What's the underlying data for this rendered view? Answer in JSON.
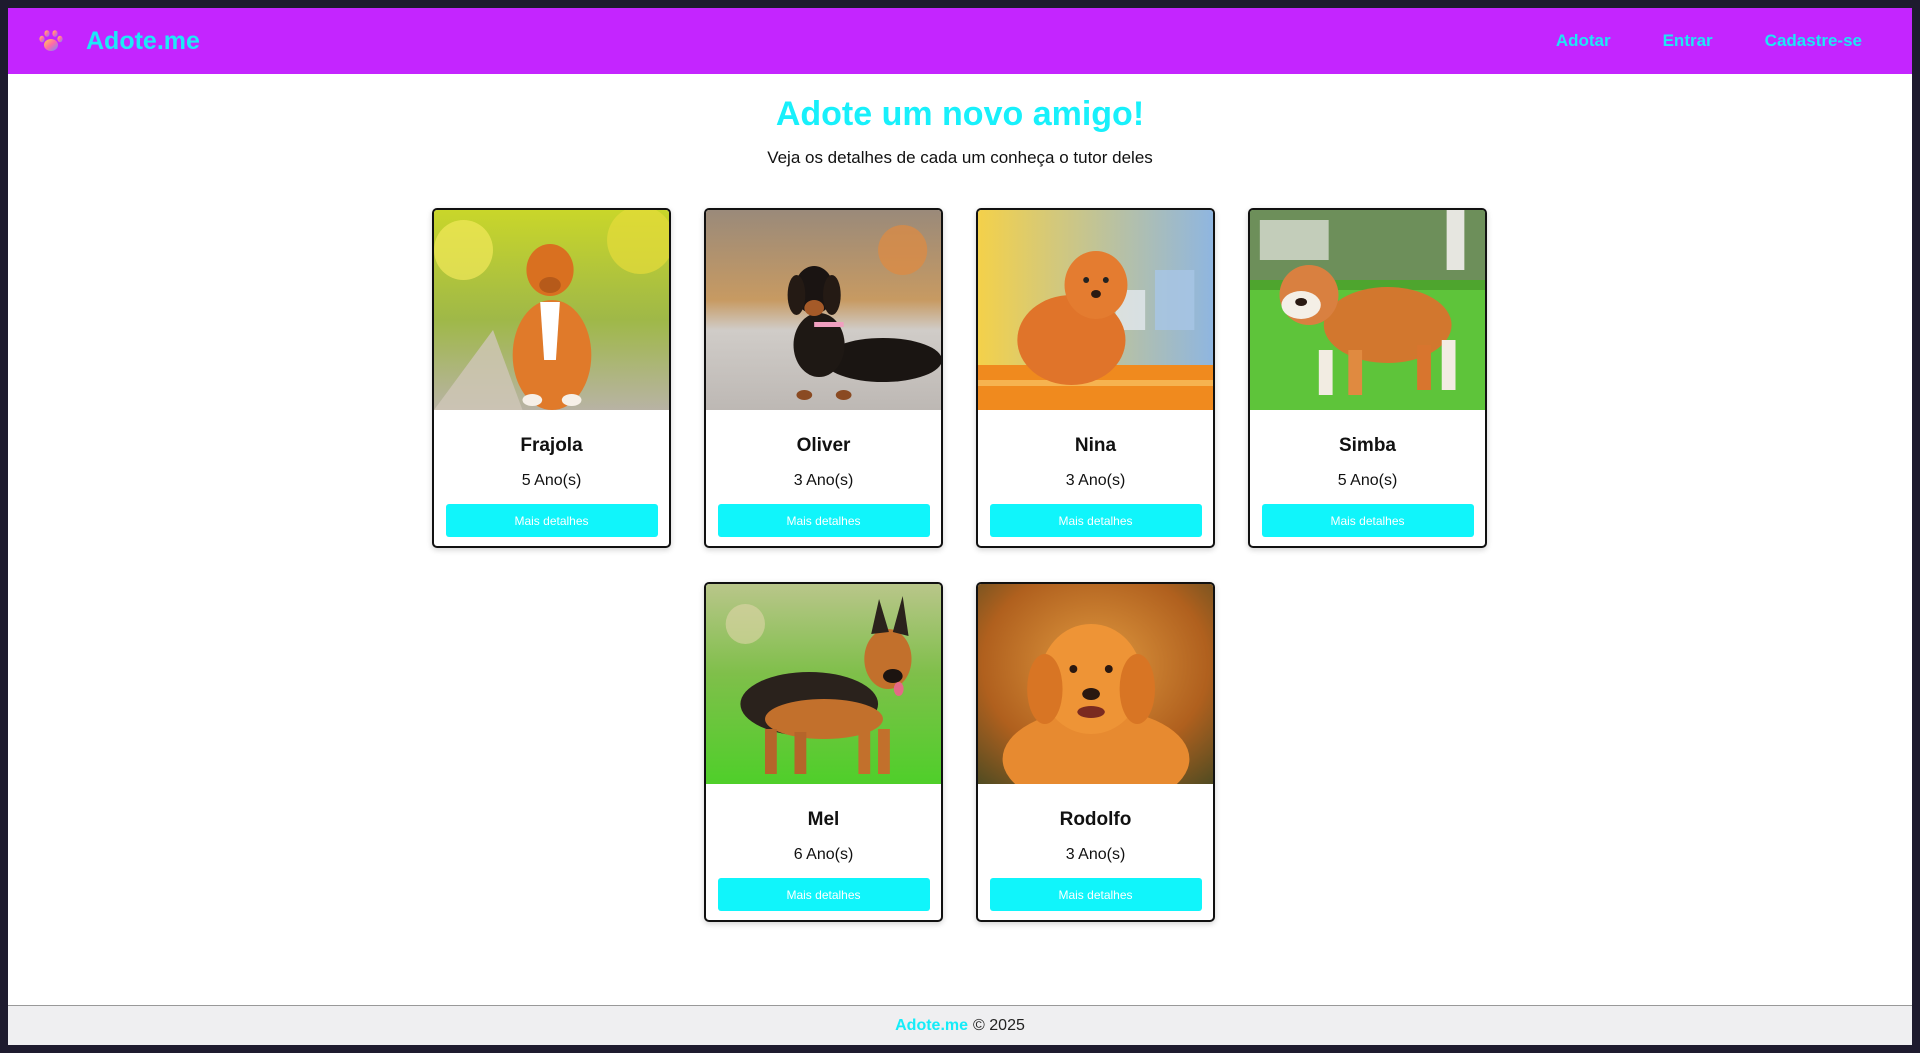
{
  "header": {
    "brand": "Adote.me",
    "logo_icon": "paw-icon",
    "nav": [
      {
        "label": "Adotar"
      },
      {
        "label": "Entrar"
      },
      {
        "label": "Cadastre-se"
      }
    ]
  },
  "hero": {
    "title": "Adote um novo amigo!",
    "subtitle": "Veja os detalhes de cada um conheça o tutor deles"
  },
  "pets": [
    {
      "name": "Frajola",
      "age": "5 Ano(s)",
      "button": "Mais detalhes"
    },
    {
      "name": "Oliver",
      "age": "3 Ano(s)",
      "button": "Mais detalhes"
    },
    {
      "name": "Nina",
      "age": "3 Ano(s)",
      "button": "Mais detalhes"
    },
    {
      "name": "Simba",
      "age": "5 Ano(s)",
      "button": "Mais detalhes"
    },
    {
      "name": "Mel",
      "age": "6 Ano(s)",
      "button": "Mais detalhes"
    },
    {
      "name": "Rodolfo",
      "age": "3 Ano(s)",
      "button": "Mais detalhes"
    }
  ],
  "footer": {
    "brand": "Adote.me",
    "copyright": "© 2025"
  },
  "colors": {
    "header_bg": "#c425ff",
    "accent_cyan": "#10f5fb",
    "footer_bg": "#efeff1"
  }
}
